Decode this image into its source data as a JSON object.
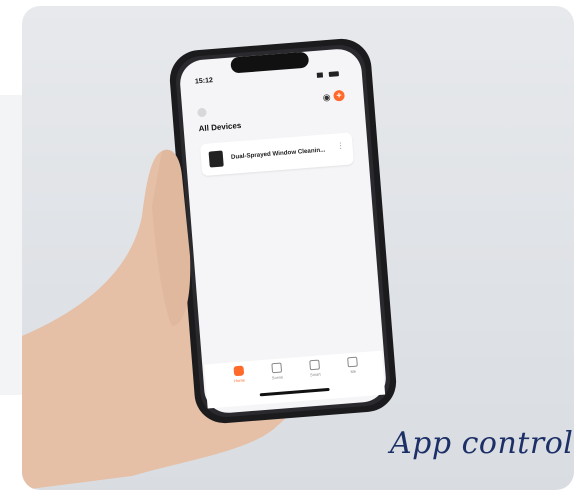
{
  "caption": "App control",
  "phone": {
    "status_time": "15:12",
    "section_title": "All Devices",
    "device_name": "Dual-Sprayed Window Cleanin...",
    "tabs": [
      {
        "label": "Home",
        "active": true
      },
      {
        "label": "Scene",
        "active": false
      },
      {
        "label": "Smart",
        "active": false
      },
      {
        "label": "Me",
        "active": false
      }
    ],
    "accent_color": "#ff6a2b"
  },
  "colors": {
    "caption": "#1c2f66",
    "background": "#e3e6ea"
  }
}
